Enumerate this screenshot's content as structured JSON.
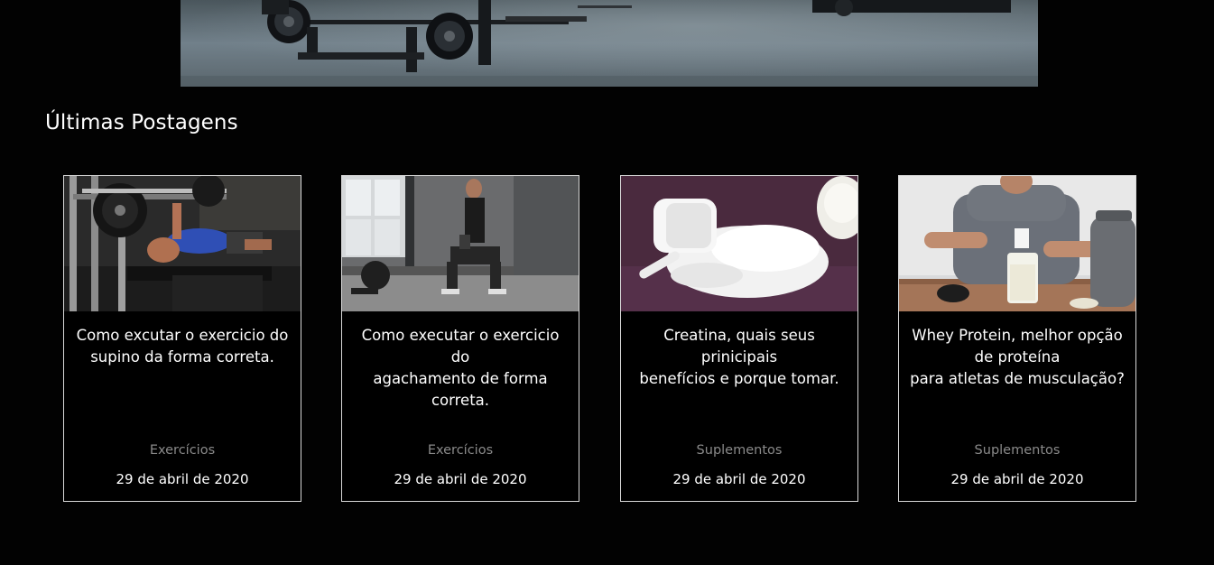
{
  "section": {
    "title": "Últimas Postagens"
  },
  "posts": [
    {
      "title_lines": [
        "Como excutar o exercicio do",
        "supino da forma correta."
      ],
      "category": "Exercícios",
      "date": "29 de abril de 2020"
    },
    {
      "title_lines": [
        "Como executar o exercicio do",
        "agachamento de forma",
        "correta."
      ],
      "category": "Exercícios",
      "date": "29 de abril de 2020"
    },
    {
      "title_lines": [
        "Creatina, quais seus",
        "prinicipais",
        "benefícios e porque tomar."
      ],
      "category": "Suplementos",
      "date": "29 de abril de 2020"
    },
    {
      "title_lines": [
        "Whey Protein, melhor opção",
        "de proteína",
        "para atletas de musculação?"
      ],
      "category": "Suplementos",
      "date": "29 de abril de 2020"
    }
  ],
  "colors": {
    "background": "#020202",
    "card_border": "#d8d8d8",
    "category_text": "#8a8a8a"
  }
}
